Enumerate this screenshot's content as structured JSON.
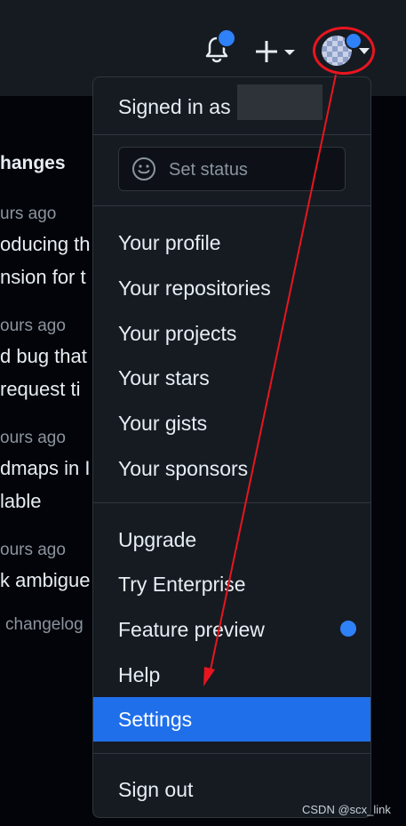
{
  "header": {
    "notifications_icon": "bell-icon",
    "create_icon": "plus-icon",
    "avatar_icon": "avatar"
  },
  "feed": {
    "title": "hanges",
    "items": [
      {
        "time": "urs ago",
        "lines": [
          "oducing th",
          "nsion for t"
        ]
      },
      {
        "time": "ours ago",
        "lines": [
          "d bug that",
          "request ti"
        ]
      },
      {
        "time": "ours ago",
        "lines": [
          "dmaps in I",
          "lable"
        ]
      },
      {
        "time": "ours ago",
        "lines": [
          "k ambigue"
        ]
      }
    ],
    "changelog_link": "changelog"
  },
  "menu": {
    "signed_in_label": "Signed in as",
    "set_status_label": "Set status",
    "profile_items": [
      "Your profile",
      "Your repositories",
      "Your projects",
      "Your stars",
      "Your gists",
      "Your sponsors"
    ],
    "other_items": [
      "Upgrade",
      "Try Enterprise",
      "Feature preview",
      "Help",
      "Settings"
    ],
    "sign_out_label": "Sign out",
    "active_item": "Settings"
  },
  "watermark": "CSDN @scx_link",
  "colors": {
    "accent": "#1f6feb",
    "badge": "#2f81f7",
    "annotation": "#e8151f"
  }
}
